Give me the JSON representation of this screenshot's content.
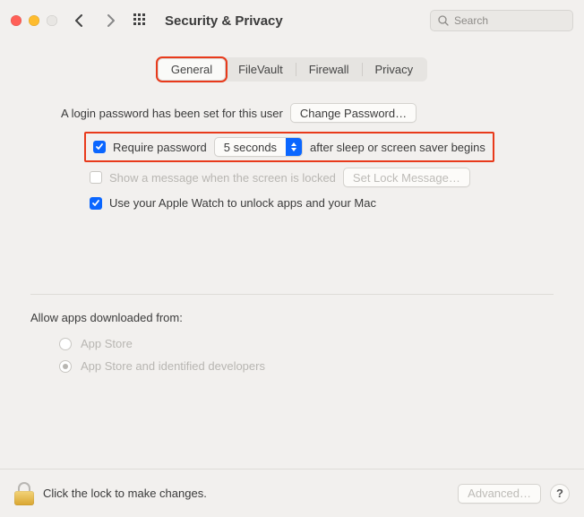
{
  "window": {
    "title": "Security & Privacy"
  },
  "search": {
    "placeholder": "Search"
  },
  "tabs": [
    {
      "label": "General",
      "selected": true,
      "highlighted": true
    },
    {
      "label": "FileVault",
      "selected": false
    },
    {
      "label": "Firewall",
      "selected": false
    },
    {
      "label": "Privacy",
      "selected": false
    }
  ],
  "login": {
    "text": "A login password has been set for this user",
    "change_btn": "Change Password…"
  },
  "require_pw": {
    "pre": "Require password",
    "select_value": "5 seconds",
    "post": "after sleep or screen saver begins",
    "checked": true,
    "highlighted": true
  },
  "lock_msg": {
    "label": "Show a message when the screen is locked",
    "btn": "Set Lock Message…",
    "checked": false,
    "enabled": false
  },
  "watch": {
    "label": "Use your Apple Watch to unlock apps and your Mac",
    "checked": true
  },
  "downloads": {
    "title": "Allow apps downloaded from:",
    "options": [
      {
        "label": "App Store",
        "selected": false
      },
      {
        "label": "App Store and identified developers",
        "selected": true
      }
    ],
    "enabled": false
  },
  "footer": {
    "lock_text": "Click the lock to make changes.",
    "advanced_btn": "Advanced…",
    "help": "?"
  },
  "colors": {
    "accent": "#0a66ff",
    "highlight": "#e83a1b"
  }
}
